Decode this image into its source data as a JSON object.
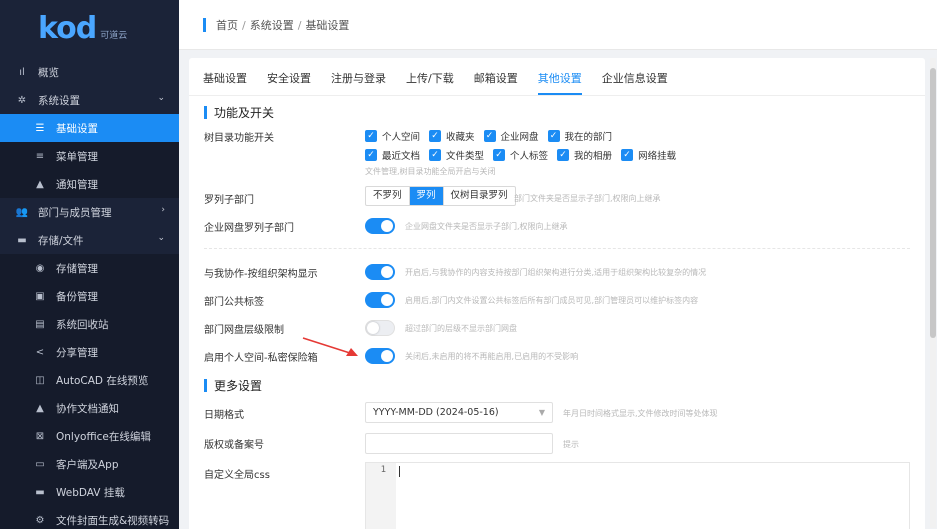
{
  "logo": {
    "text": "kod",
    "sub": "可道云"
  },
  "sidebar": {
    "items": [
      {
        "label": "概览",
        "icon": "bar-chart-icon",
        "glyph": "ıl"
      },
      {
        "label": "系统设置",
        "icon": "gear-icon",
        "glyph": "✲",
        "arrow": "⌄"
      },
      {
        "label": "基础设置",
        "icon": "sliders-icon",
        "glyph": "☰",
        "active": true
      },
      {
        "label": "菜单管理",
        "icon": "menu-icon",
        "glyph": "≡"
      },
      {
        "label": "通知管理",
        "icon": "bell-icon",
        "glyph": "▲"
      },
      {
        "label": "部门与成员管理",
        "icon": "users-icon",
        "glyph": "👥",
        "arrow": "›"
      },
      {
        "label": "存储/文件",
        "icon": "folder-icon",
        "glyph": "▬",
        "arrow": "⌄"
      },
      {
        "label": "存储管理",
        "icon": "database-icon",
        "glyph": "◉"
      },
      {
        "label": "备份管理",
        "icon": "save-icon",
        "glyph": "▣"
      },
      {
        "label": "系统回收站",
        "icon": "trash-icon",
        "glyph": "▤"
      },
      {
        "label": "分享管理",
        "icon": "share-icon",
        "glyph": "<"
      },
      {
        "label": "AutoCAD 在线预览",
        "icon": "cad-icon",
        "glyph": "◫"
      },
      {
        "label": "协作文档通知",
        "icon": "bell-icon",
        "glyph": "▲"
      },
      {
        "label": "Onlyoffice在线编辑",
        "icon": "office-icon",
        "glyph": "⊠"
      },
      {
        "label": "客户端及App",
        "icon": "monitor-icon",
        "glyph": "▭"
      },
      {
        "label": "WebDAV 挂载",
        "icon": "webdav-icon",
        "glyph": "▬"
      },
      {
        "label": "文件封面生成&视频转码",
        "icon": "gear-icon",
        "glyph": "⚙"
      }
    ]
  },
  "breadcrumb": {
    "items": [
      "首页",
      "系统设置",
      "基础设置"
    ],
    "sep": "/"
  },
  "tabs": [
    "基础设置",
    "安全设置",
    "注册与登录",
    "上传/下载",
    "邮箱设置",
    "其他设置",
    "企业信息设置"
  ],
  "active_tab": 5,
  "section1": {
    "title": "功能及开关",
    "tree": {
      "label": "树目录功能开关",
      "row1": [
        "个人空间",
        "收藏夹",
        "企业网盘",
        "我在的部门"
      ],
      "row2": [
        "最近文档",
        "文件类型",
        "个人标签",
        "我的相册",
        "网络挂载"
      ],
      "hint": "文件管理,树目录功能全局开启与关闭"
    },
    "sublist": {
      "label": "罗列子部门",
      "options": [
        "不罗列",
        "罗列",
        "仅树目录罗列"
      ],
      "selected": 1,
      "hint": "部门文件夹是否显示子部门,权限向上继承"
    },
    "enterprise": {
      "label": "企业网盘罗列子部门",
      "on": true,
      "hint": "企业网盘文件夹是否显示子部门,权限向上继承"
    },
    "collab": {
      "label": "与我协作-按组织架构显示",
      "on": true,
      "hint": "开启后,与我协作的内容支持按部门组织架构进行分类,适用于组织架构比较复杂的情况"
    },
    "dept_tags": {
      "label": "部门公共标签",
      "on": true,
      "hint": "启用后,部门内文件设置公共标签后所有部门成员可见,部门管理员可以维护标签内容"
    },
    "dept_level": {
      "label": "部门网盘层级限制",
      "on": false,
      "hint": "超过部门的层级不显示部门网盘"
    },
    "safebox": {
      "label": "启用个人空间-私密保险箱",
      "on": true,
      "hint": "关闭后,未启用的将不再能启用,已启用的不受影响"
    }
  },
  "section2": {
    "title": "更多设置",
    "date_format": {
      "label": "日期格式",
      "value": "YYYY-MM-DD (2024-05-16)",
      "hint": "年月日时间格式显示,文件修改时间等处体现"
    },
    "copyright": {
      "label": "版权或备案号",
      "value": "",
      "hint": "提示"
    },
    "css": {
      "label": "自定义全局css",
      "line": "1"
    }
  },
  "colors": {
    "accent": "#1b8cf4",
    "sidebar_bg": "#1b2338",
    "pointer": "#e53935"
  }
}
